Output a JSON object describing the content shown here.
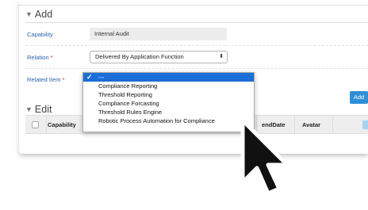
{
  "add_section": {
    "title": "Add",
    "capability": {
      "label": "Capability",
      "value": "Internal Audit"
    },
    "relation": {
      "label": "Relation",
      "required_mark": "*",
      "value": "Delivered By Application Function"
    },
    "related_item": {
      "label": "Related Item",
      "required_mark": "*"
    },
    "add_button": "Add"
  },
  "dropdown": {
    "options": [
      {
        "label": "---",
        "selected": true
      },
      {
        "label": "Compliance Reporting",
        "selected": false
      },
      {
        "label": "Threshold Reporting",
        "selected": false
      },
      {
        "label": "Compliance Forcasting",
        "selected": false
      },
      {
        "label": "Threshold Rules Engine",
        "selected": false
      },
      {
        "label": "Robotic Process Automation for Compliance",
        "selected": false
      }
    ]
  },
  "edit_section": {
    "title": "Edit",
    "columns": [
      "Capability",
      "endDate",
      "Avatar"
    ]
  },
  "icons": {
    "collapse": "caret-down-icon",
    "select_arrows": "select-arrows-icon",
    "check": "checkmark-icon",
    "add_row": "plus-icon",
    "expand": "expand-icon",
    "cursor": "mouse-pointer-icon"
  },
  "colors": {
    "accent": "#2f8fd6",
    "label": "#2a64a8",
    "required": "#d8261c",
    "selected_option": "#1a6ed8"
  }
}
